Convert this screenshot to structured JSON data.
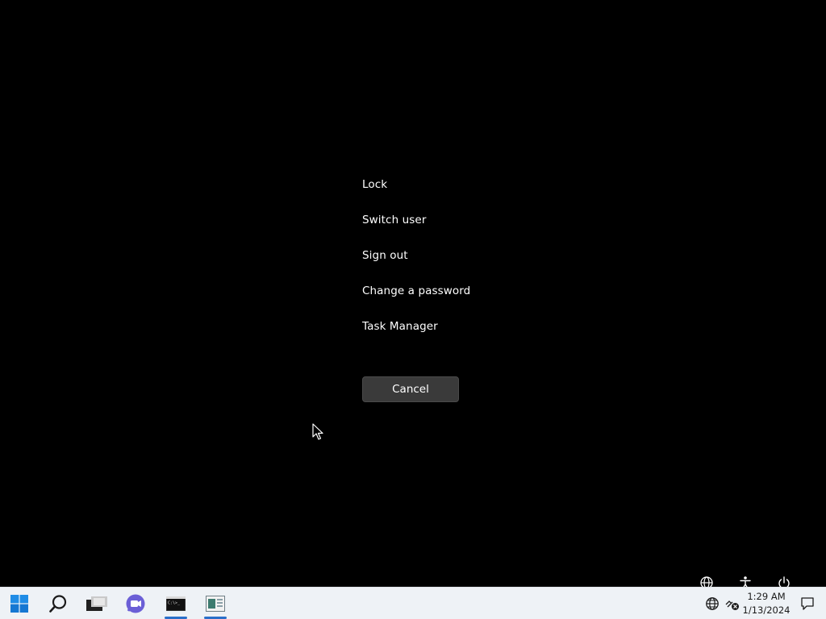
{
  "security_menu": {
    "items": [
      {
        "label": "Lock"
      },
      {
        "label": "Switch user"
      },
      {
        "label": "Sign out"
      },
      {
        "label": "Change a password"
      },
      {
        "label": "Task Manager"
      }
    ],
    "cancel_label": "Cancel"
  },
  "corner_icons": [
    "network-icon",
    "accessibility-icon",
    "power-icon"
  ],
  "taskbar": {
    "apps": [
      {
        "name": "start-button",
        "icon": "windows-logo-icon",
        "active": false
      },
      {
        "name": "search-button",
        "icon": "search-icon",
        "active": false
      },
      {
        "name": "file-explorer-button",
        "icon": "folder-icon",
        "active": false
      },
      {
        "name": "teams-chat-button",
        "icon": "chat-icon",
        "active": false
      },
      {
        "name": "terminal-button",
        "icon": "terminal-icon",
        "active": true
      },
      {
        "name": "app-window-button",
        "icon": "app-window-icon",
        "active": true
      }
    ],
    "tray": {
      "icons": [
        "globe-icon",
        "network-disconnected-icon",
        "notification-icon"
      ],
      "time": "1:29 AM",
      "date": "1/13/2024"
    },
    "colors": {
      "background": "#eef2f6",
      "accent": "#2a6fc9"
    }
  }
}
